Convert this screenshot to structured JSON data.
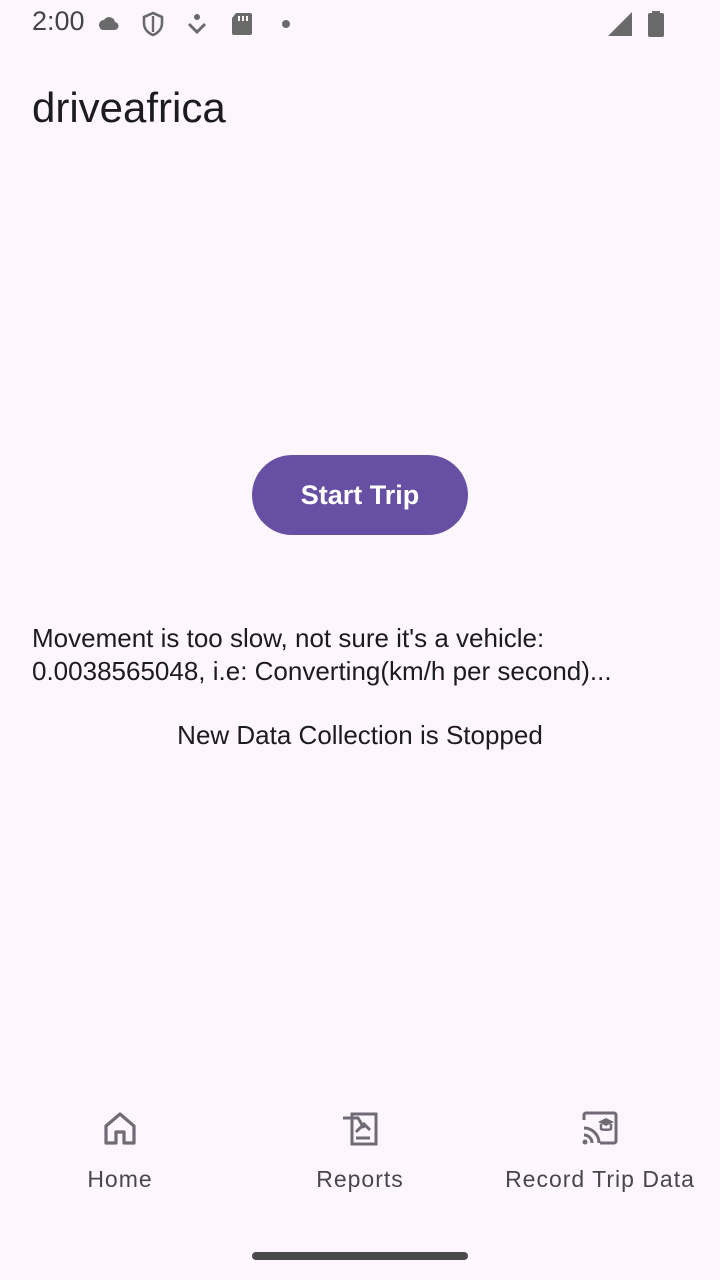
{
  "status_bar": {
    "time": "2:00"
  },
  "app": {
    "title": "driveafrica"
  },
  "main": {
    "start_button_label": "Start Trip",
    "movement_message": "Movement is too slow, not sure it's a vehicle: 0.0038565048, i.e: Converting(km/h per second)...",
    "collection_status": "New Data Collection is Stopped"
  },
  "bottom_nav": {
    "items": [
      {
        "label": "Home",
        "icon": "home-icon"
      },
      {
        "label": "Reports",
        "icon": "reports-icon"
      },
      {
        "label": "Record Trip Data",
        "icon": "cast-icon"
      }
    ]
  },
  "colors": {
    "background": "#fdf7fd",
    "primary": "#6750a4",
    "nav_text": "#49454f"
  }
}
